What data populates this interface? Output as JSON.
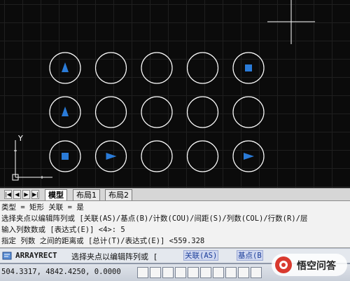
{
  "canvas": {
    "bg_color": "#0b0b0b",
    "grid_color": "#1f1f1f",
    "circle_color": "#ffffff",
    "grip_color": "#2a7bd8",
    "ucs_axis_y_label": "Y",
    "array": {
      "rows": 3,
      "columns": 5,
      "grips": [
        {
          "row": 0,
          "col": 0,
          "shape": "triangle-up"
        },
        {
          "row": 0,
          "col": 4,
          "shape": "square"
        },
        {
          "row": 1,
          "col": 0,
          "shape": "triangle-up"
        },
        {
          "row": 2,
          "col": 0,
          "shape": "square"
        },
        {
          "row": 2,
          "col": 1,
          "shape": "triangle-right"
        },
        {
          "row": 2,
          "col": 4,
          "shape": "triangle-right"
        }
      ]
    }
  },
  "tabs": {
    "nav_buttons": [
      "|◀",
      "◀",
      "▶",
      "▶|"
    ],
    "items": [
      {
        "label": "模型",
        "active": true
      },
      {
        "label": "布局1",
        "active": false
      },
      {
        "label": "布局2",
        "active": false
      }
    ]
  },
  "history": {
    "lines": [
      "类型 = 矩形  关联 = 是",
      "选择夹点以编辑阵列或 [关联(AS)/基点(B)/计数(COU)/间距(S)/列数(COL)/行数(R)/层",
      "输入列数数或 [表达式(E)] <4>: 5",
      "指定 列数 之间的距离或 [总计(T)/表达式(E)] <559.328"
    ]
  },
  "command": {
    "name": "ARRAYRECT",
    "prompt": "选择夹点以编辑阵列或 [",
    "kw1": "关联(AS)",
    "kw2": "基点(B"
  },
  "status": {
    "coords": "504.3317, 4842.4250, 0.0000"
  },
  "watermark": {
    "text": "悟空问答"
  }
}
